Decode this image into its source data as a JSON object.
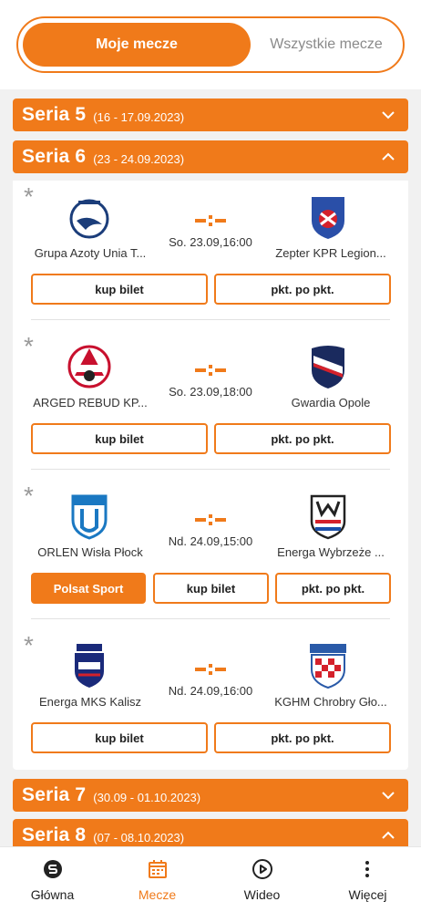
{
  "toggle": {
    "active": "Moje mecze",
    "inactive": "Wszystkie mecze"
  },
  "series": [
    {
      "name": "Seria 5",
      "dates": "(16 - 17.09.2023)"
    },
    {
      "name": "Seria 6",
      "dates": "(23 - 24.09.2023)"
    },
    {
      "name": "Seria 7",
      "dates": "(30.09 - 01.10.2023)"
    },
    {
      "name": "Seria 8",
      "dates": "(07 - 08.10.2023)"
    }
  ],
  "matches": [
    {
      "star": "*",
      "home": "Grupa Azoty Unia T...",
      "away": "Zepter KPR Legion...",
      "time": "So. 23.09,16:00",
      "buttons": [
        "kup bilet",
        "pkt. po pkt."
      ]
    },
    {
      "star": "*",
      "home": "ARGED REBUD KP...",
      "away": "Gwardia Opole",
      "time": "So. 23.09,18:00",
      "buttons": [
        "kup bilet",
        "pkt. po pkt."
      ]
    },
    {
      "star": "*",
      "home": "ORLEN Wisła Płock",
      "away": "Energa Wybrzeże ...",
      "time": "Nd. 24.09,15:00",
      "buttons": [
        "Polsat Sport",
        "kup bilet",
        "pkt. po pkt."
      ]
    },
    {
      "star": "*",
      "home": "Energa MKS Kalisz",
      "away": "KGHM Chrobry Gło...",
      "time": "Nd. 24.09,16:00",
      "buttons": [
        "kup bilet",
        "pkt. po pkt."
      ]
    }
  ],
  "nav": [
    {
      "label": "Główna",
      "icon": "home-logo-icon"
    },
    {
      "label": "Mecze",
      "icon": "calendar-icon"
    },
    {
      "label": "Wideo",
      "icon": "play-icon"
    },
    {
      "label": "Więcej",
      "icon": "more-vertical-icon"
    }
  ],
  "colors": {
    "accent": "#f07a1a",
    "background": "#f1f1f1"
  }
}
